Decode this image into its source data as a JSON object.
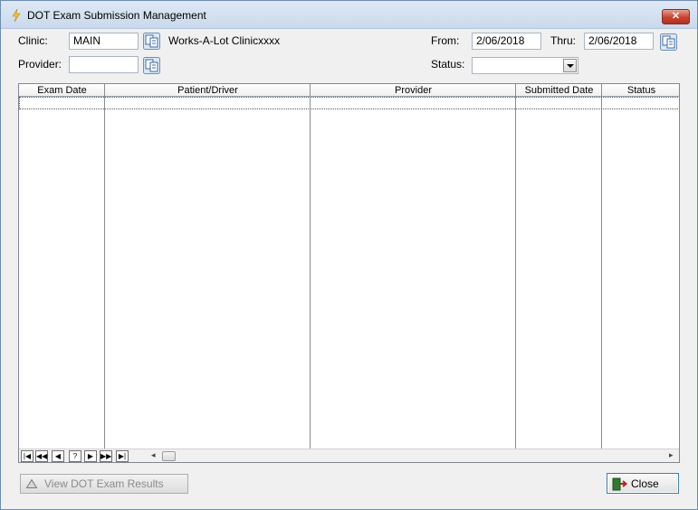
{
  "window": {
    "title": "DOT Exam Submission Management",
    "close_glyph": "✕"
  },
  "filters": {
    "clinic_label": "Clinic:",
    "clinic_value": "MAIN",
    "clinic_name": "Works-A-Lot Clinicxxxx",
    "provider_label": "Provider:",
    "provider_value": "",
    "from_label": "From:",
    "from_value": "2/06/2018",
    "thru_label": "Thru:",
    "thru_value": "2/06/2018",
    "status_label": "Status:",
    "status_value": ""
  },
  "grid": {
    "columns": [
      "Exam Date",
      "Patient/Driver",
      "Provider",
      "Submitted Date",
      "Status"
    ],
    "rows": []
  },
  "navigator": {
    "buttons": [
      "|◀",
      "◀◀",
      "◀",
      "?",
      "▶",
      "▶▶",
      "▶|"
    ],
    "scroll_left": "◂",
    "scroll_right": "▸"
  },
  "footer": {
    "view_results_label": "View DOT Exam Results",
    "close_label": "Close"
  },
  "colors": {
    "title_gradient_top": "#dfe9f5",
    "close_red": "#c7432f",
    "window_bg": "#f0f0f0"
  }
}
